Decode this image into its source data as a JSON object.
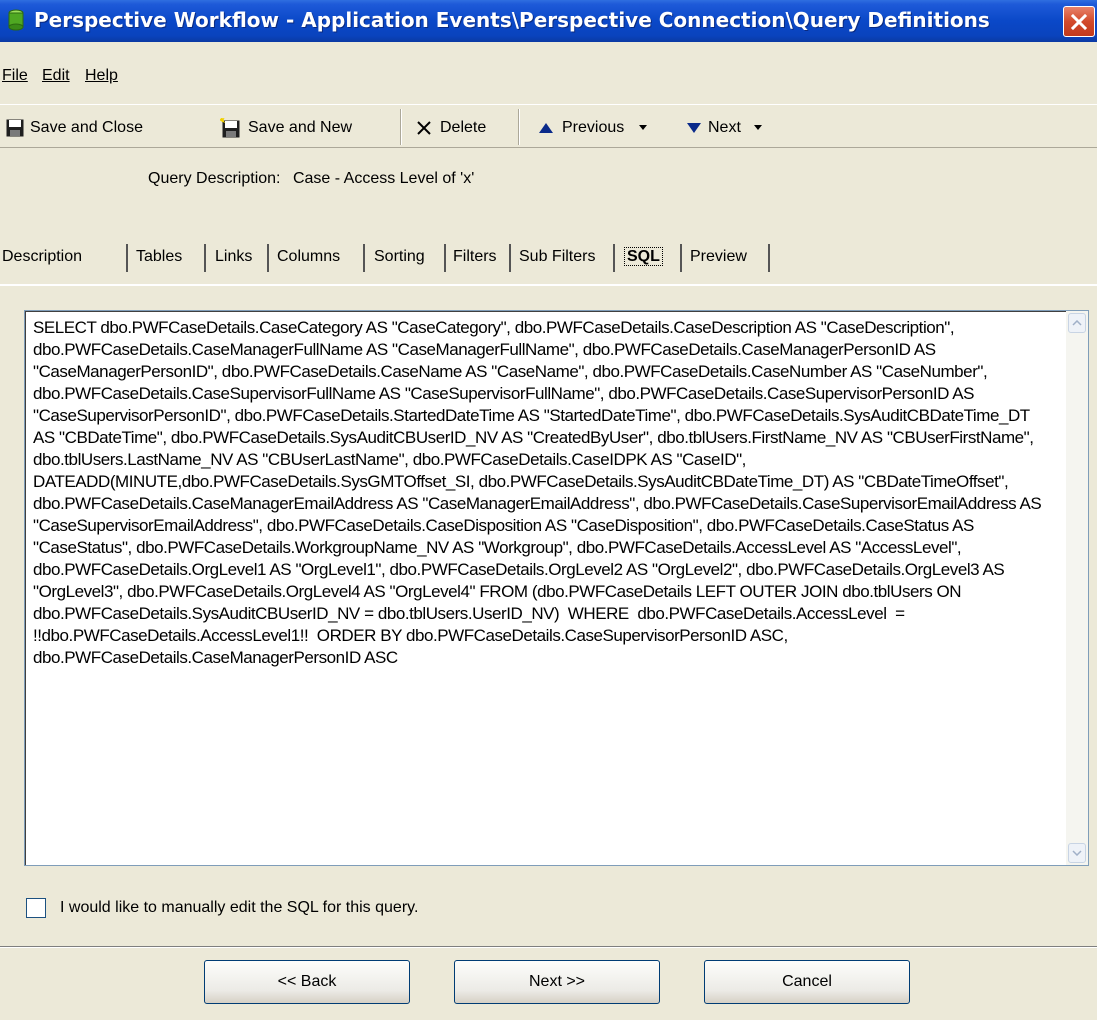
{
  "window": {
    "title": "Perspective Workflow - Application Events\\Perspective Connection\\Query Definitions"
  },
  "menu": [
    {
      "label": "File"
    },
    {
      "label": "Edit"
    },
    {
      "label": "Help"
    }
  ],
  "toolbar": {
    "save_close": "Save and Close",
    "save_new": "Save and New",
    "delete": "Delete",
    "previous": "Previous",
    "next": "Next"
  },
  "query": {
    "label": "Query Description:",
    "value": "Case - Access Level of 'x'"
  },
  "tabs": [
    {
      "label": "Description"
    },
    {
      "label": "Tables"
    },
    {
      "label": "Links"
    },
    {
      "label": "Columns"
    },
    {
      "label": "Sorting"
    },
    {
      "label": "Filters"
    },
    {
      "label": "Sub Filters"
    },
    {
      "label": "SQL",
      "active": true
    },
    {
      "label": "Preview"
    }
  ],
  "sql": {
    "text": "SELECT dbo.PWFCaseDetails.CaseCategory AS \"CaseCategory\", dbo.PWFCaseDetails.CaseDescription AS \"CaseDescription\", dbo.PWFCaseDetails.CaseManagerFullName AS \"CaseManagerFullName\", dbo.PWFCaseDetails.CaseManagerPersonID AS \"CaseManagerPersonID\", dbo.PWFCaseDetails.CaseName AS \"CaseName\", dbo.PWFCaseDetails.CaseNumber AS \"CaseNumber\", dbo.PWFCaseDetails.CaseSupervisorFullName AS \"CaseSupervisorFullName\", dbo.PWFCaseDetails.CaseSupervisorPersonID AS \"CaseSupervisorPersonID\", dbo.PWFCaseDetails.StartedDateTime AS \"StartedDateTime\", dbo.PWFCaseDetails.SysAuditCBDateTime_DT AS \"CBDateTime\", dbo.PWFCaseDetails.SysAuditCBUserID_NV AS \"CreatedByUser\", dbo.tblUsers.FirstName_NV AS \"CBUserFirstName\", dbo.tblUsers.LastName_NV AS \"CBUserLastName\", dbo.PWFCaseDetails.CaseIDPK AS \"CaseID\", DATEADD(MINUTE,dbo.PWFCaseDetails.SysGMTOffset_SI, dbo.PWFCaseDetails.SysAuditCBDateTime_DT) AS \"CBDateTimeOffset\", dbo.PWFCaseDetails.CaseManagerEmailAddress AS \"CaseManagerEmailAddress\", dbo.PWFCaseDetails.CaseSupervisorEmailAddress AS \"CaseSupervisorEmailAddress\", dbo.PWFCaseDetails.CaseDisposition AS \"CaseDisposition\", dbo.PWFCaseDetails.CaseStatus AS \"CaseStatus\", dbo.PWFCaseDetails.WorkgroupName_NV AS \"Workgroup\", dbo.PWFCaseDetails.AccessLevel AS \"AccessLevel\", dbo.PWFCaseDetails.OrgLevel1 AS \"OrgLevel1\", dbo.PWFCaseDetails.OrgLevel2 AS \"OrgLevel2\", dbo.PWFCaseDetails.OrgLevel3 AS \"OrgLevel3\", dbo.PWFCaseDetails.OrgLevel4 AS \"OrgLevel4\" FROM (dbo.PWFCaseDetails LEFT OUTER JOIN dbo.tblUsers ON dbo.PWFCaseDetails.SysAuditCBUserID_NV = dbo.tblUsers.UserID_NV)  WHERE  dbo.PWFCaseDetails.AccessLevel  =  !!dbo.PWFCaseDetails.AccessLevel1!!  ORDER BY dbo.PWFCaseDetails.CaseSupervisorPersonID ASC, dbo.PWFCaseDetails.CaseManagerPersonID ASC"
  },
  "manual_edit": {
    "label": "I would like to manually edit the SQL for this query.",
    "checked": false
  },
  "buttons": {
    "back": "<< Back",
    "next": "Next >>",
    "cancel": "Cancel"
  },
  "icons": {
    "app": "app-cylinder-icon",
    "close": "close-icon",
    "save_close": "floppy-disk-icon",
    "save_new": "floppy-disk-new-icon",
    "delete": "x-delete-icon",
    "previous": "up-arrow-icon",
    "next": "down-arrow-icon"
  },
  "colors": {
    "titlebar": "#0a48c8",
    "window_bg": "#ece9d8",
    "close_btn": "#d24a2b"
  }
}
